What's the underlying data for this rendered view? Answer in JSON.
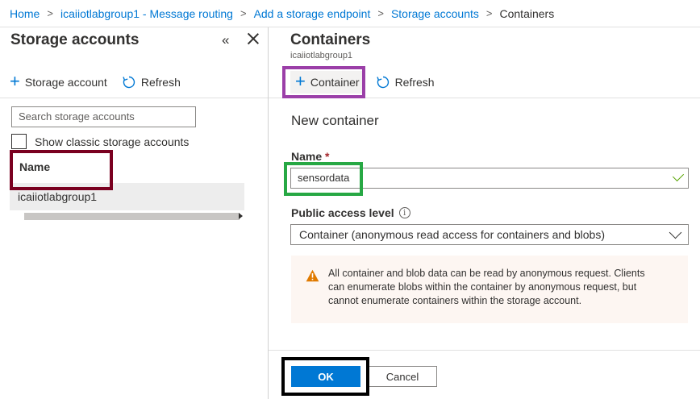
{
  "breadcrumb": {
    "items": [
      "Home",
      "icaiiotlabgroup1 - Message routing",
      "Add a storage endpoint",
      "Storage accounts"
    ],
    "current": "Containers",
    "separator": ">"
  },
  "left_pane": {
    "title": "Storage accounts",
    "collapse_glyph": "«",
    "toolbar": {
      "add_label": "Storage account",
      "refresh_label": "Refresh"
    },
    "search": {
      "placeholder": "Search storage accounts"
    },
    "show_classic_label": "Show classic storage accounts",
    "column_header": "Name",
    "accounts": [
      "icaiiotlabgroup1"
    ]
  },
  "right_pane": {
    "title": "Containers",
    "subtitle": "icaiiotlabgroup1",
    "toolbar": {
      "add_label": "Container",
      "refresh_label": "Refresh"
    },
    "form": {
      "title": "New container",
      "name_label": "Name",
      "required_mark": "*",
      "name_value": "sensordata",
      "access_label": "Public access level",
      "info_glyph": "i",
      "access_value": "Container (anonymous read access for containers and blobs)",
      "warning_lines": [
        "All container and blob data can be read by anonymous request. Clients",
        "can enumerate blobs within the container by anonymous request, but",
        "cannot enumerate containers within the storage account."
      ]
    },
    "footer": {
      "ok_label": "OK",
      "cancel_label": "Cancel"
    }
  },
  "colors": {
    "accent": "#0078d4",
    "highlight_red": "#7a0020",
    "highlight_purple": "#9b3fa8",
    "highlight_green": "#27a844",
    "highlight_black": "#000000",
    "warning": "#e07a00",
    "valid_check": "#57a300"
  }
}
